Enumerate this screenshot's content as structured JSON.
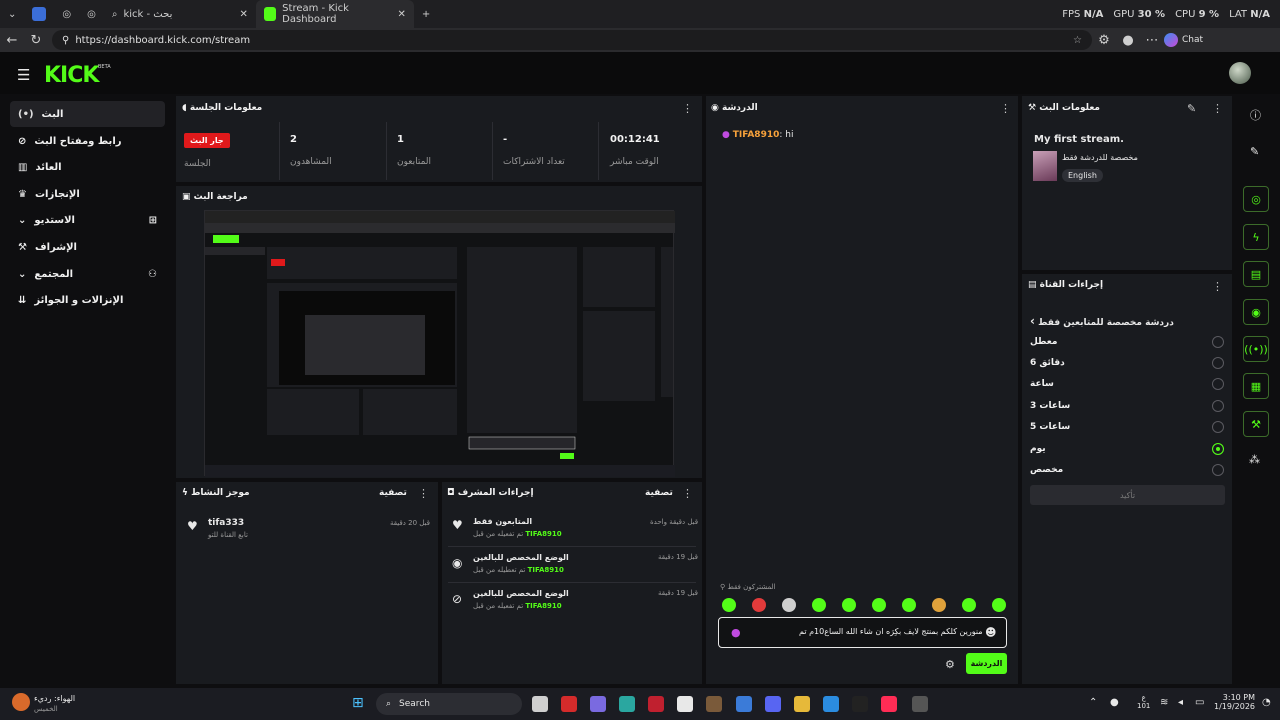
{
  "browser": {
    "tabs": [
      {
        "label": "kick - بحث"
      },
      {
        "label": "Stream - Kick Dashboard"
      }
    ],
    "stats": {
      "fps_label": "FPS",
      "fps_value": "N/A",
      "gpu_label": "GPU",
      "gpu_value": "30 %",
      "cpu_label": "CPU",
      "cpu_value": "9 %",
      "lat_label": "LAT",
      "lat_value": "N/A"
    },
    "url": "https://dashboard.kick.com/stream",
    "chat_label": "Chat"
  },
  "kick": {
    "logo": "KICK",
    "beta": "BETA"
  },
  "sidebar": {
    "items": [
      {
        "label": "البث",
        "icon": "live-icon",
        "active": true
      },
      {
        "label": "رابط ومفتاح البث",
        "icon": "link-icon"
      },
      {
        "label": "العائد",
        "icon": "chart-icon"
      },
      {
        "label": "الإنجازات",
        "icon": "trophy-icon"
      },
      {
        "label": "الاستديو",
        "icon": "chevron-down-icon"
      },
      {
        "label": "الإشراف",
        "icon": "hammer-icon"
      },
      {
        "label": "المجتمع",
        "icon": "chevron-down-icon"
      },
      {
        "label": "الإنزالات و الجوائز",
        "icon": "drops-icon"
      }
    ]
  },
  "session": {
    "title": "معلومات الجلسة",
    "live_badge": "جار البث",
    "session_label": "الجلسة",
    "viewers_value": "2",
    "viewers_label": "المشاهدون",
    "followers_value": "1",
    "followers_label": "المتابعون",
    "subs_value": "-",
    "subs_label": "تعداد الاشتراكات",
    "time_value": "00:12:41",
    "time_label": "الوقت مباشر"
  },
  "preview": {
    "title": "مراجعة البث"
  },
  "chat": {
    "title": "الدردشة",
    "messages": [
      {
        "user": "TIFA8910",
        "text": ": hi"
      }
    ],
    "subscribers_only": "المشتركون فقط",
    "input_text": "منورين كلكم بمنتج لايف بكِرَه ان شاء الله الساع10م تم",
    "send_label": "الدردشة"
  },
  "stream_info": {
    "title": "معلومات البث",
    "stream_title": "My first stream.",
    "category": "مخصصة للدردشة فقط",
    "language": "English"
  },
  "channel_actions": {
    "title": "إجراءات القناة",
    "submenu_title": "دردشة مخصصة للمتابعين فقط",
    "options": [
      {
        "label": "معطل",
        "selected": false
      },
      {
        "label": "6 دقائق",
        "selected": false
      },
      {
        "label": "ساعة",
        "selected": false
      },
      {
        "label": "3 ساعات",
        "selected": false
      },
      {
        "label": "5 ساعات",
        "selected": false
      },
      {
        "label": "يوم",
        "selected": true
      },
      {
        "label": "مخصص",
        "selected": false
      }
    ],
    "confirm_label": "تأكيد"
  },
  "activity": {
    "title": "موجز النشاط",
    "filter": "تصفية",
    "items": [
      {
        "user": "tifa333",
        "text": "تابع القناة للتو",
        "time": "قبل 20 دقيقة"
      }
    ]
  },
  "mod_actions": {
    "title": "إجراءات المشرف",
    "filter": "تصفية",
    "items": [
      {
        "title": "المتابعون فقط",
        "sub_prefix": "تم تفعيله من قبل",
        "user": "TIFA8910",
        "time": "قبل دقيقة واحدة"
      },
      {
        "title": "الوضع المخصص للبالغين",
        "sub_prefix": "تم تعطيله من قبل",
        "user": "TIFA8910",
        "time": "قبل 19 دقيقة"
      },
      {
        "title": "الوضع المخصص للبالغين",
        "sub_prefix": "تم تفعيله من قبل",
        "user": "TIFA8910",
        "time": "قبل 19 دقيقة"
      }
    ]
  },
  "taskbar": {
    "weather": "الهواء: رديء",
    "weather_sub": "الخميس",
    "search_label": "Search",
    "time": "3:10 PM",
    "date": "1/19/2026",
    "lang": "ع",
    "kb": "101"
  },
  "colors": {
    "accent": "#53fc18",
    "panel": "#191b1f",
    "live": "#e0191b"
  }
}
